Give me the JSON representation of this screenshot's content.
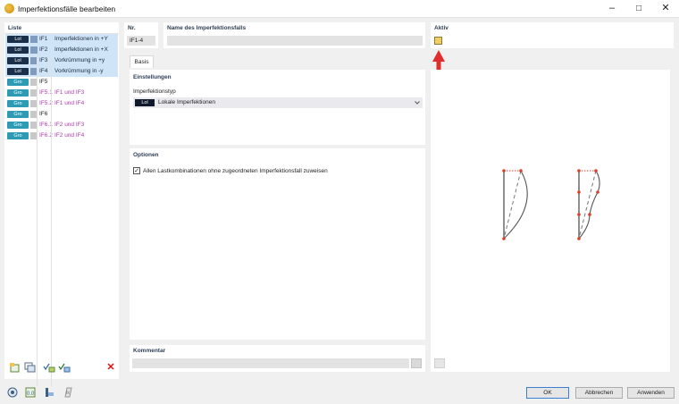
{
  "window": {
    "title": "Imperfektionsfälle bearbeiten",
    "minimize": "–",
    "maximize": "□",
    "close": "✕"
  },
  "list": {
    "header": "Liste",
    "items": [
      {
        "tag": "Lol",
        "nr": "IF1",
        "name": "Imperfektionen in +Y",
        "tag_color": "#1a2f4a",
        "swatch": "#7f9cc0",
        "text_color": "#1c2b40"
      },
      {
        "tag": "Lol",
        "nr": "IF2",
        "name": "Imperfektionen in +X",
        "tag_color": "#1a2f4a",
        "swatch": "#7f9cc0",
        "text_color": "#1c2b40"
      },
      {
        "tag": "Lol",
        "nr": "IF3",
        "name": "Vorkrümmung in +y",
        "tag_color": "#1a2f4a",
        "swatch": "#7f9cc0",
        "text_color": "#1c2b40"
      },
      {
        "tag": "Lol",
        "nr": "IF4",
        "name": "Vorkrümmung in -y",
        "tag_color": "#1a2f4a",
        "swatch": "#7f9cc0",
        "text_color": "#1c2b40"
      },
      {
        "tag": "Gro",
        "nr": "IF5",
        "name": "",
        "tag_color": "#2e9bb5",
        "swatch": "#c8c8c8",
        "text_color": "#222222"
      },
      {
        "tag": "Gro",
        "nr": "IF5.1",
        "name": "IF1 und IF3",
        "tag_color": "#2e9bb5",
        "swatch": "#c8c8c8",
        "text_color": "#b03ab0"
      },
      {
        "tag": "Gro",
        "nr": "IF5.2",
        "name": "IF1 und IF4",
        "tag_color": "#2e9bb5",
        "swatch": "#c8c8c8",
        "text_color": "#b03ab0"
      },
      {
        "tag": "Gro",
        "nr": "IF6",
        "name": "",
        "tag_color": "#2e9bb5",
        "swatch": "#c8c8c8",
        "text_color": "#222222"
      },
      {
        "tag": "Gro",
        "nr": "IF6.1",
        "name": "IF2 und IF3",
        "tag_color": "#2e9bb5",
        "swatch": "#c8c8c8",
        "text_color": "#b03ab0"
      },
      {
        "tag": "Gro",
        "nr": "IF6.2",
        "name": "IF2 und IF4",
        "tag_color": "#2e9bb5",
        "swatch": "#c8c8c8",
        "text_color": "#b03ab0"
      }
    ],
    "delete_glyph": "✕"
  },
  "nr": {
    "label": "Nr.",
    "value": "IF1-4"
  },
  "name_field": {
    "label": "Name des Imperfektionsfalls",
    "value": ""
  },
  "aktiv": {
    "label": "Aktiv"
  },
  "tabs": [
    {
      "label": "Basis"
    }
  ],
  "einstellungen": {
    "header": "Einstellungen",
    "type_label": "Imperfektionstyp",
    "type_tag": "Lol",
    "type_value": "Lokale Imperfektionen"
  },
  "optionen": {
    "header": "Optionen",
    "checkbox_label": "Allen Lastkombinationen ohne zugeordneten Imperfektionsfall zuweisen",
    "checkbox_mark": "✓"
  },
  "kommentar": {
    "header": "Kommentar",
    "value": ""
  },
  "buttons": {
    "ok": "OK",
    "cancel": "Abbrechen",
    "apply": "Anwenden"
  },
  "icons": [
    "help-icon",
    "units-icon",
    "model-icon",
    "script-icon"
  ],
  "colors": {
    "accent": "#2f3f57",
    "selection": "#cfe4f7",
    "node": "#d9402b",
    "arrow": "#e02d2d",
    "aktiv_box": "#f3cf62"
  }
}
